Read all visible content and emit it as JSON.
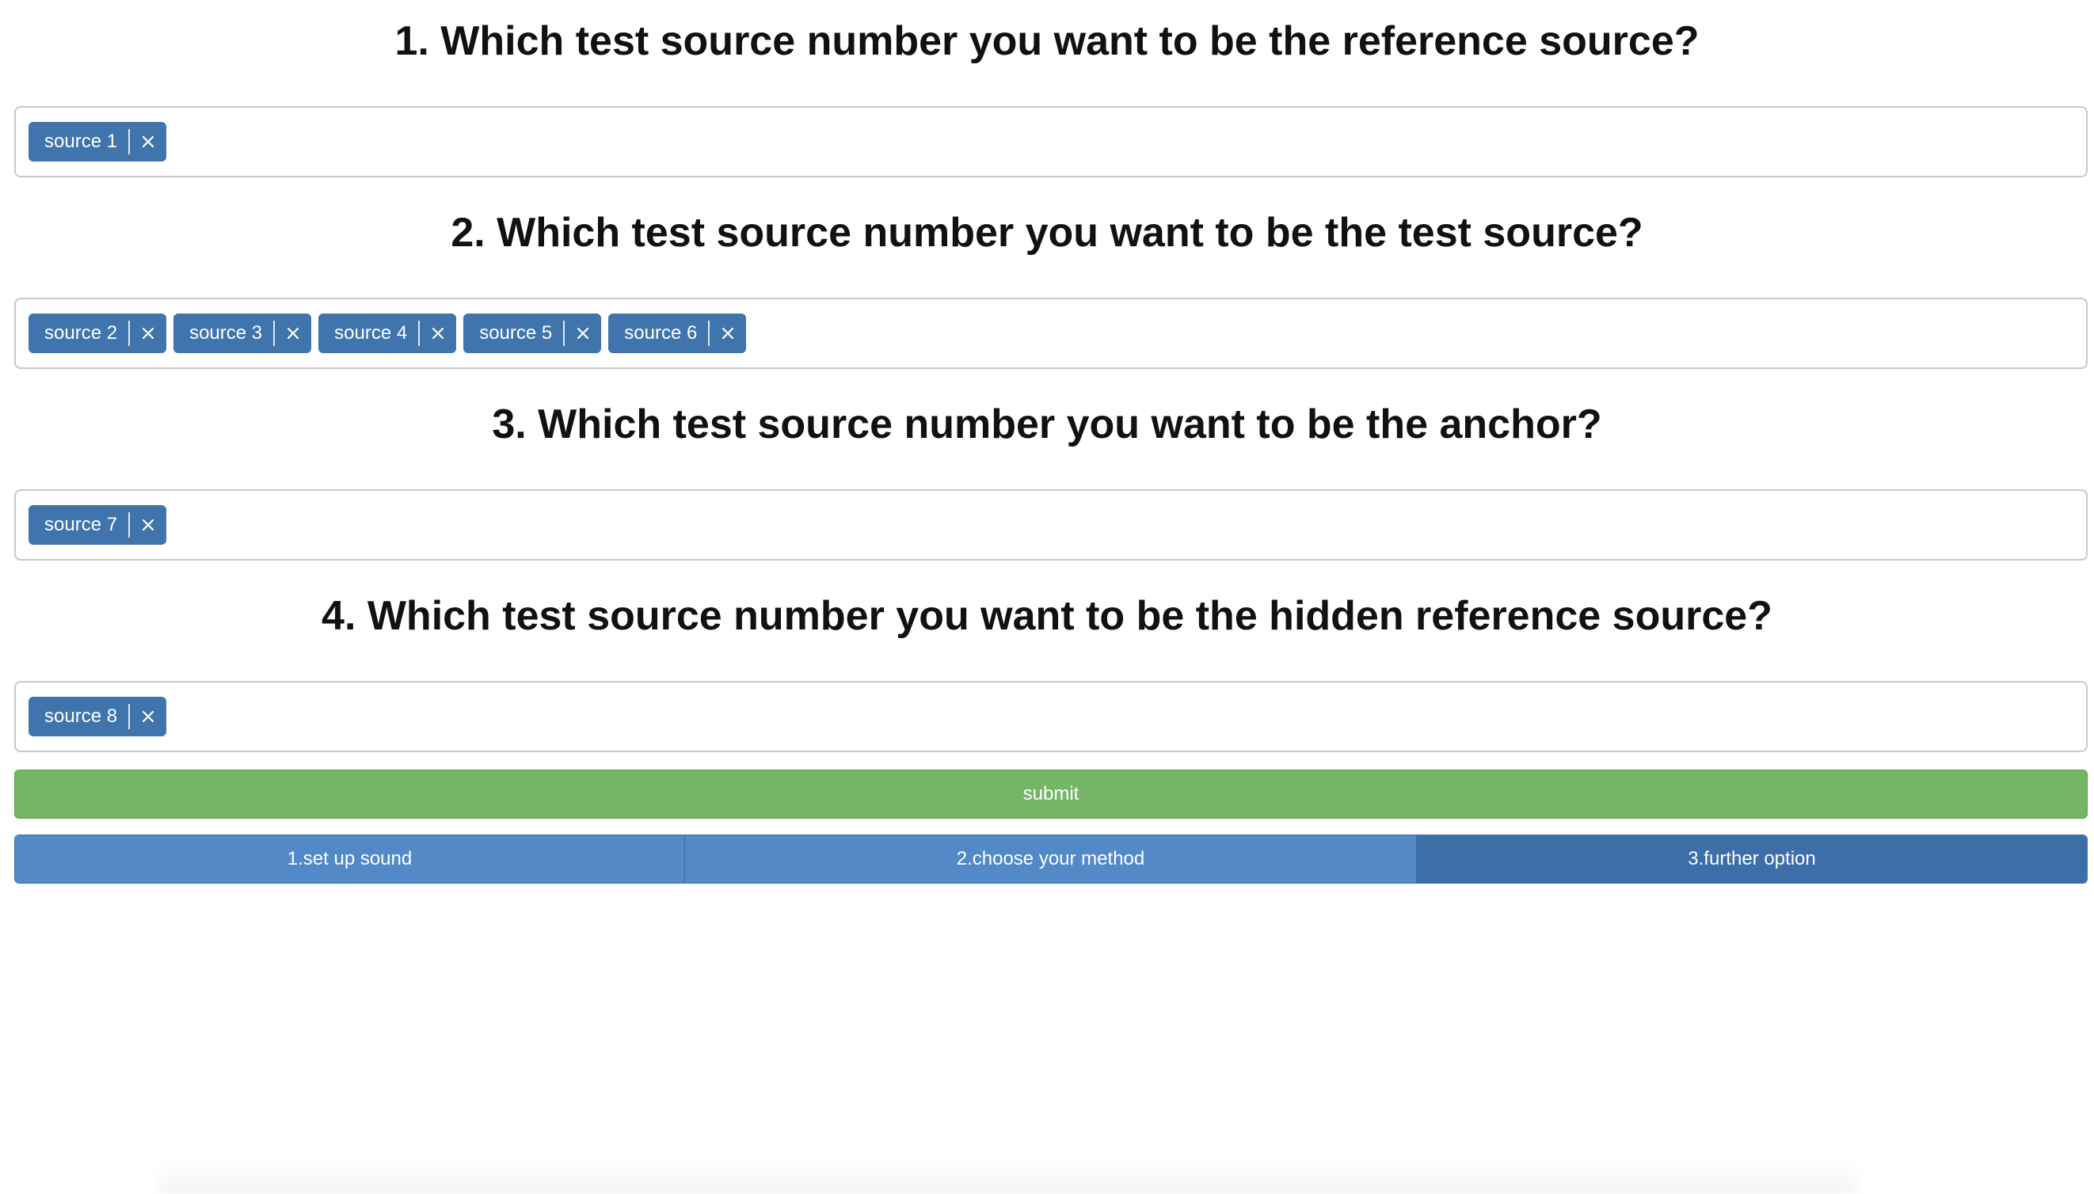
{
  "questions": [
    {
      "title": "1. Which test source number you want to be the reference source?",
      "tags": [
        "source 1"
      ]
    },
    {
      "title": "2. Which test source number you want to be the test source?",
      "tags": [
        "source 2",
        "source 3",
        "source 4",
        "source 5",
        "source 6"
      ]
    },
    {
      "title": "3. Which test source number you want to be the anchor?",
      "tags": [
        "source 7"
      ]
    },
    {
      "title": "4. Which test source number you want to be the hidden reference source?",
      "tags": [
        "source 8"
      ]
    }
  ],
  "submit_label": "submit",
  "steps": [
    "1.set up sound",
    "2.choose your method",
    "3.further option"
  ],
  "colors": {
    "tag": "#3f74ad",
    "submit": "#75b566",
    "step": "#5389c6",
    "step_active": "#3e6ea8"
  },
  "icons": {
    "tag_remove": "close-icon"
  }
}
